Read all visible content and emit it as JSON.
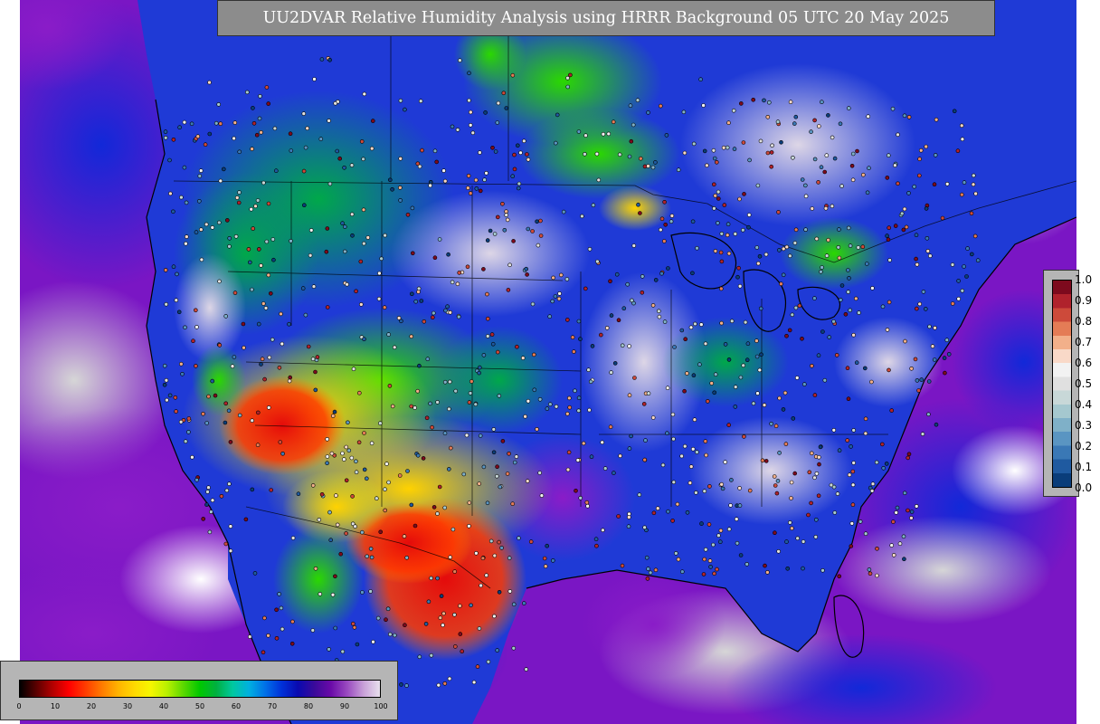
{
  "title": "UU2DVAR Relative Humidity Analysis using HRRR Background 05 UTC 20 May 2025",
  "map": {
    "ocean_colors": [
      "#0a1fcc",
      "#3355ee",
      "#7a16c4",
      "#9b63c9",
      "#c8c8c8",
      "#ffffff"
    ],
    "land_colors": {
      "very_dry": "#e40b0b",
      "dry": "#ff7a00",
      "moderate_dry": "#f6e400",
      "moderate": "#2bd800",
      "moist": "#00a84a",
      "humid": "#2c6ad8",
      "very_humid": "#1a22d0",
      "saturated": "#6a14b0",
      "near_saturated": "#d9d3e2"
    },
    "boundary_color": "#000000"
  },
  "obs_legend": {
    "ticks": [
      "1.0",
      "0.9",
      "0.8",
      "0.7",
      "0.6",
      "0.5",
      "0.4",
      "0.3",
      "0.2",
      "0.1",
      "0.0"
    ],
    "colors": [
      "#0a3d7a",
      "#1f5aa0",
      "#3a78b5",
      "#5a95c2",
      "#7fb0c8",
      "#a5c8cf",
      "#c8d8d8",
      "#e0e0e0",
      "#f2f2f2",
      "#f9d9c8",
      "#f2b08a",
      "#e47c56",
      "#cd4a3a",
      "#b0222c",
      "#7d0a1d"
    ]
  },
  "rh_legend": {
    "ticks": [
      "0",
      "10",
      "20",
      "30",
      "40",
      "50",
      "60",
      "70",
      "80",
      "90",
      "100"
    ],
    "stops": [
      "#000000",
      "#5a0000",
      "#b30000",
      "#ff0000",
      "#ff3b00",
      "#ff7a00",
      "#ffb300",
      "#ffd900",
      "#f6f600",
      "#b8f000",
      "#5ad800",
      "#00c800",
      "#00b040",
      "#00c8a0",
      "#00b0e0",
      "#0070e8",
      "#0030d8",
      "#0a0ab0",
      "#3a0a9a",
      "#6a0aa8",
      "#9a4ac0",
      "#c8a0d8",
      "#e8e0ee"
    ]
  }
}
